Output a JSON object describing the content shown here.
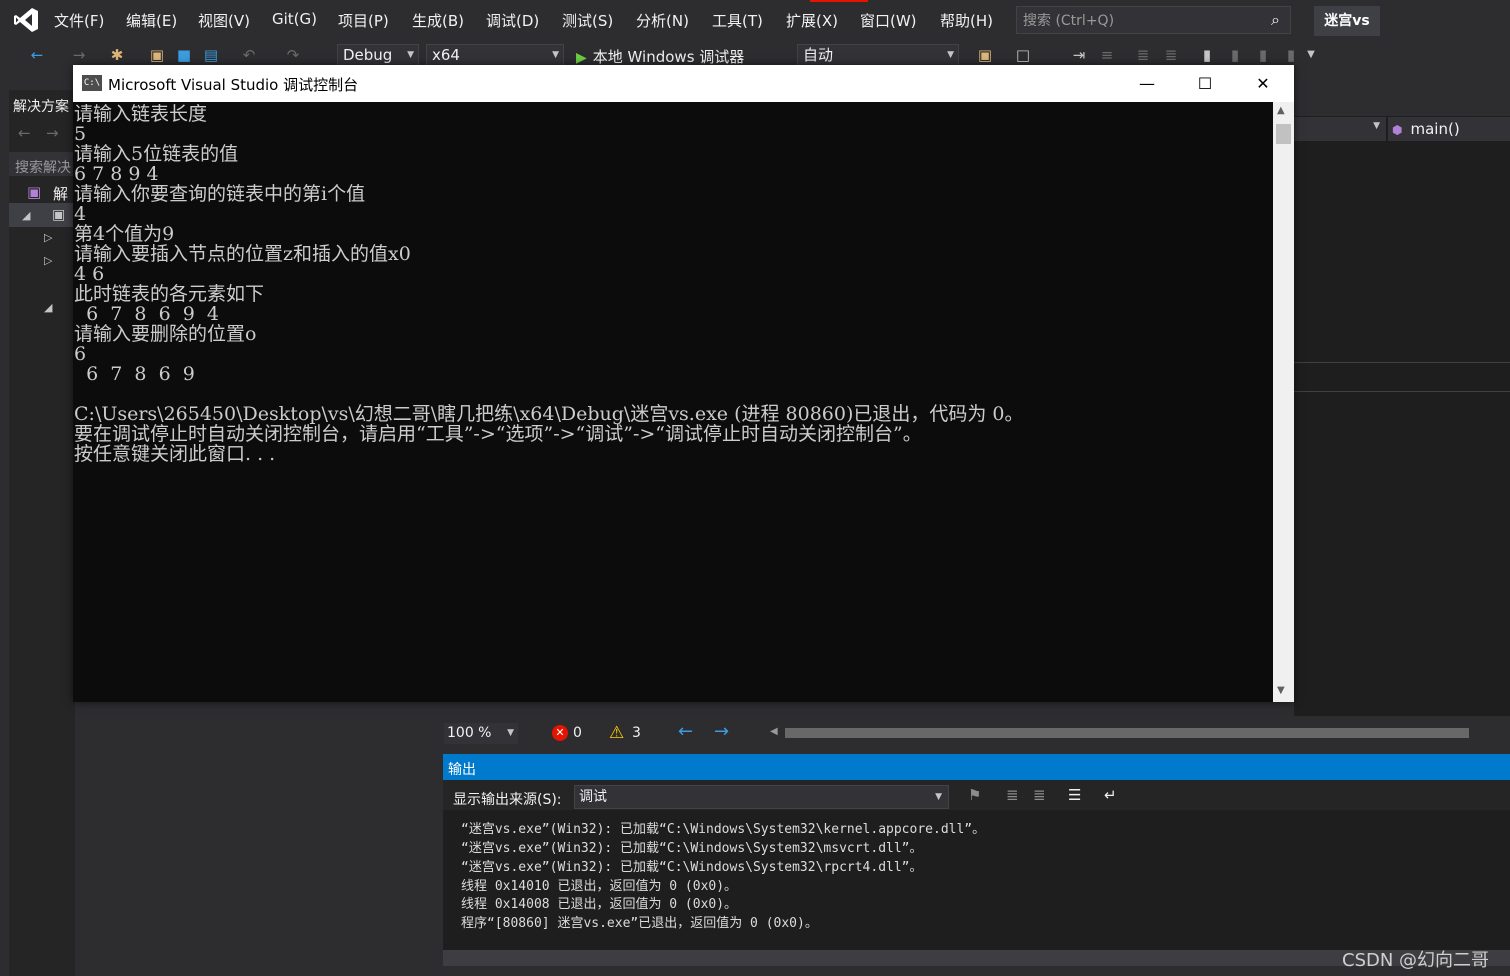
{
  "menu": {
    "items": [
      "文件(F)",
      "编辑(E)",
      "视图(V)",
      "Git(G)",
      "项目(P)",
      "生成(B)",
      "调试(D)",
      "测试(S)",
      "分析(N)",
      "工具(T)",
      "扩展(X)",
      "窗口(W)",
      "帮助(H)"
    ],
    "search_placeholder": "搜索 (Ctrl+Q)",
    "solution_name": "迷宫vs"
  },
  "toolbar": {
    "config": "Debug",
    "platform": "x64",
    "debugger": "本地 Windows 调试器",
    "auto": "自动"
  },
  "solution_explorer": {
    "title": "解决方案",
    "search": "搜索解决",
    "root_item": "解"
  },
  "editor": {
    "function": "main()"
  },
  "console": {
    "title": "Microsoft Visual Studio 调试控制台",
    "icon_text": "C:\\",
    "lines": [
      "请输入链表长度",
      "5",
      "请输入5位链表的值",
      "6 7 8 9 4",
      "请输入你要查询的链表中的第i个值",
      "4",
      "第4个值为9",
      "请输入要插入节点的位置z和插入的值x0",
      "4 6",
      "此时链表的各元素如下",
      "  6  7  8  6  9  4",
      "请输入要删除的位置o",
      "6",
      "  6  7  8  6  9",
      "",
      "C:\\Users\\265450\\Desktop\\vs\\幻想二哥\\瞎几把练\\x64\\Debug\\迷宫vs.exe (进程 80860)已退出，代码为 0。",
      "要在调试停止时自动关闭控制台，请启用“工具”->“选项”->“调试”->“调试停止时自动关闭控制台”。",
      "按任意键关闭此窗口. . ."
    ]
  },
  "status": {
    "zoom": "100 %",
    "errors": "0",
    "warnings": "3"
  },
  "output": {
    "title": "输出",
    "source_label": "显示输出来源(S):",
    "source_value": "调试",
    "lines": [
      "“迷宫vs.exe”(Win32): 已加载“C:\\Windows\\System32\\kernel.appcore.dll”。",
      "“迷宫vs.exe”(Win32): 已加载“C:\\Windows\\System32\\msvcrt.dll”。",
      "“迷宫vs.exe”(Win32): 已加载“C:\\Windows\\System32\\rpcrt4.dll”。",
      "线程 0x14010 已退出，返回值为 0 (0x0)。",
      "线程 0x14008 已退出，返回值为 0 (0x0)。",
      "程序“[80860] 迷宫vs.exe”已退出，返回值为 0 (0x0)。"
    ]
  },
  "watermark": "CSDN @幻向二哥",
  "colors": {
    "accent": "#007acc",
    "console_bg": "#0c0c0c",
    "ide_bg": "#2d2d30",
    "error": "#e51400",
    "warning": "#ffcc00"
  }
}
